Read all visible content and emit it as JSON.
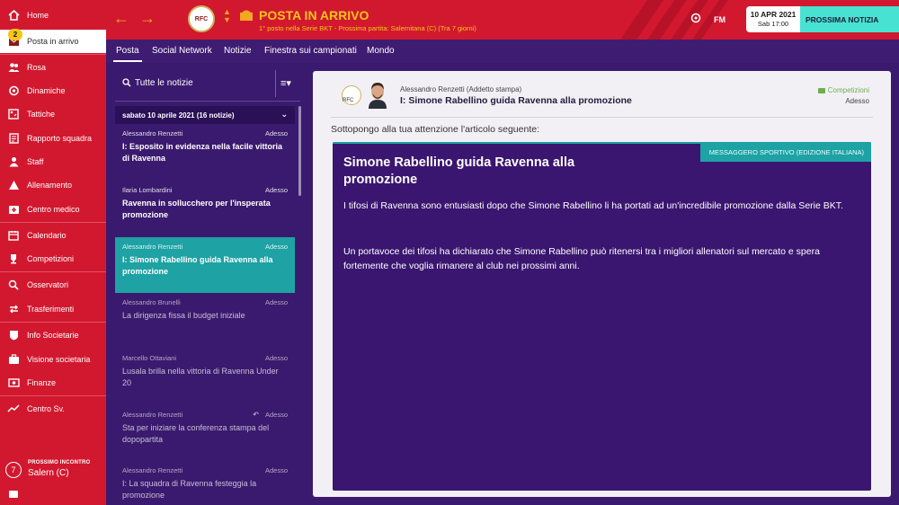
{
  "sidebar": {
    "inbox_badge": "2",
    "items": [
      {
        "label": "Home",
        "icon": "home-icon"
      },
      {
        "label": "Posta in arrivo",
        "icon": "inbox-icon"
      },
      {
        "label": "Rosa",
        "icon": "squad-icon"
      },
      {
        "label": "Dinamiche",
        "icon": "dynamics-icon"
      },
      {
        "label": "Tattiche",
        "icon": "tactics-icon"
      },
      {
        "label": "Rapporto squadra",
        "icon": "report-icon"
      },
      {
        "label": "Staff",
        "icon": "staff-icon"
      },
      {
        "label": "Allenamento",
        "icon": "training-icon"
      },
      {
        "label": "Centro medico",
        "icon": "medical-icon"
      },
      {
        "label": "Calendario",
        "icon": "calendar-icon"
      },
      {
        "label": "Competizioni",
        "icon": "trophy-icon"
      },
      {
        "label": "Osservatori",
        "icon": "scouting-icon"
      },
      {
        "label": "Trasferimenti",
        "icon": "transfers-icon"
      },
      {
        "label": "Info Societarie",
        "icon": "club-info-icon"
      },
      {
        "label": "Visione societaria",
        "icon": "club-vision-icon"
      },
      {
        "label": "Finanze",
        "icon": "finances-icon"
      },
      {
        "label": "Centro Sv.",
        "icon": "dev-centre-icon"
      }
    ],
    "next_match": {
      "label": "PROSSIMO INCONTRO",
      "value": "Salern (C)",
      "number": "7"
    }
  },
  "header": {
    "club_logo_text": "RFC",
    "title": "POSTA IN ARRIVO",
    "subtitle": "1° posto nella Serie BKT - Prossima partita: Salernitana (C) (Tra 7 giorni)",
    "fm_label": "FM",
    "date": "10 APR 2021",
    "time": "Sab 17:00",
    "continue_label": "PROSSIMA NOTIZIA"
  },
  "tabs": [
    "Posta",
    "Social Network",
    "Notizie",
    "Finestra sui campionati",
    "Mondo"
  ],
  "list": {
    "filter_label": "Tutte le notizie",
    "group_header": "sabato 10 aprile 2021 (16 notizie)",
    "messages": [
      {
        "from": "Alessandro Renzetti",
        "when": "Adesso",
        "subject": "I: Esposito in evidenza nella facile vittoria di Ravenna"
      },
      {
        "from": "Ilaria Lombardini",
        "when": "Adesso",
        "subject": "Ravenna in sollucchero per l'insperata promozione"
      },
      {
        "from": "Alessandro Renzetti",
        "when": "Adesso",
        "subject": "I: Simone Rabellino guida Ravenna alla promozione"
      },
      {
        "from": "Alessandro Brunelli",
        "when": "Adesso",
        "subject": "La dirigenza fissa il budget iniziale"
      },
      {
        "from": "Marcello Ottaviani",
        "when": "Adesso",
        "subject": "Lusala brilla nella vittoria di Ravenna Under 20"
      },
      {
        "from": "Alessandro Renzetti",
        "when": "Adesso",
        "subject": "Sta per iniziare la conferenza stampa del dopopartita"
      },
      {
        "from": "Alessandro Renzetti",
        "when": "Adesso",
        "subject": "I: La squadra di Ravenna festeggia la promozione"
      }
    ]
  },
  "reading": {
    "logo_text": "RFC",
    "sender": "Alessandro Renzetti  (Addetto stampa)",
    "subject": "I: Simone Rabellino guida Ravenna alla promozione",
    "category": "Competizioni",
    "posted": "Adesso",
    "intro": "Sottopongo alla tua attenzione l'articolo seguente:",
    "article": {
      "source": "MESSAGGERO SPORTIVO (EDIZIONE ITALIANA)",
      "headline": "Simone Rabellino guida Ravenna alla promozione",
      "body1": "I tifosi di Ravenna sono entusiasti dopo che Simone Rabellino li ha portati ad un'incredibile promozione dalla Serie BKT.",
      "body2": "Un portavoce dei tifosi ha dichiarato che Simone Rabellino può ritenersi tra i migliori allenatori sul mercato e spera fortemente che voglia rimanere al club nei prossimi anni."
    }
  },
  "colors": {
    "brand_red": "#d2182f",
    "accent_yellow": "#f5c518",
    "teal": "#1ea2a4",
    "purple": "#3a1a6e"
  }
}
